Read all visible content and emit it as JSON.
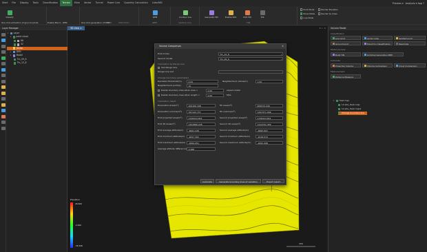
{
  "menubar": {
    "items": [
      "Start",
      "File",
      "Display",
      "Tools",
      "Classification",
      "Terrain",
      "Mine",
      "Vector",
      "Tunnel",
      "Power Line",
      "Quantity Calculation",
      "Lidar360"
    ],
    "active_index": 5,
    "right": {
      "themes": "Themes ▾",
      "help": "Analysis ▾  App  ?"
    }
  },
  "ribbon": {
    "groups": [
      {
        "label": "Classification"
      },
      {
        "label": "DEM"
      },
      {
        "label": "DEM"
      },
      {
        "label": "Contour line"
      },
      {
        "label": "TIN"
      }
    ],
    "buttons": {
      "classify": "Classify",
      "one_click_ground": "One click extraction of ground points",
      "enable_macro": "Enable Macro",
      "dem": "DEM",
      "one_click_dem": "One click generation of DEM",
      "dem_editor": "DEM Editor",
      "dem2": "DEM",
      "contour": "Contour line",
      "gen_tin": "Generate TIN",
      "enable_edit": "Enable Edit",
      "edit_tin": "Edit TIN",
      "tin": "TIN",
      "point_mode": "Point Mode",
      "render_elevation": "Render Elevation",
      "plane_mode": "Plane Mode",
      "render_by_class": "Render by Class",
      "line_mode": "Line Mode"
    }
  },
  "layer_manager": {
    "title": "Layer Manager",
    "root": "Layer",
    "items": [
      {
        "label": "point cloud",
        "depth": 1
      },
      {
        "label": "68",
        "depth": 2
      },
      {
        "label": "32",
        "depth": 2
      },
      {
        "label": "Vector",
        "depth": 1,
        "selected": true
      },
      {
        "label": "DEM",
        "depth": 1
      },
      {
        "label": "Model",
        "depth": 1
      },
      {
        "label": "Tin_09_6",
        "depth": 2
      },
      {
        "label": "Tin_12_8",
        "depth": 2
      }
    ]
  },
  "viewport": {
    "tab": "3D View ×",
    "legend": {
      "title": "Elevation",
      "max": "28.960",
      "mid": "-2.660",
      "min": "-36.298"
    },
    "scale": "200"
  },
  "dialog": {
    "title": "Volume Comparison",
    "first_model_label": "First model",
    "first_model_value": "Tin_12_8",
    "second_model_label": "Second model",
    "second_model_value": "Tin_09_6",
    "range_section": "Calculation by Range Line",
    "use_range_line": "Use Range Line",
    "range_line_list": "Range Line List",
    "params_section": "Change boundary parameters",
    "deviation_label": "Deviation threshold(m)",
    "deviation_value": "0.02",
    "neighborhood_radius_label": "Neighborhood radius(m)",
    "neighborhood_radius_value": "1.00",
    "neighborhood_points_label": "Neighborhood point(s)",
    "neighborhood_points_value": "10",
    "delete_area_label": "Delete boundary lines when area <",
    "delete_area_value": "0.00",
    "delete_area_unit": "square meter",
    "delete_length_label": "Delete boundary lines when length <",
    "delete_length_value": "0.00",
    "delete_length_unit": "Mtrs",
    "results_section": "Calculation result",
    "results": [
      {
        "l": "Excavation area(m²)",
        "lv": "469166.398",
        "r": "Fill area(m²)",
        "rv": "669570.049"
      },
      {
        "l": "Excavation volume(m³)",
        "lv": "397122.757",
        "r": "Fill volume(m³)",
        "rv": "1297371.946"
      },
      {
        "l": "First projected area(m²)",
        "lv": "1156224.821",
        "r": "Second projected area(m²)",
        "rv": "1156224.821"
      },
      {
        "l": "First 3D area(m²)",
        "lv": "1452886.228",
        "r": "Second 3D area(m²)",
        "rv": "1414791.459"
      },
      {
        "l": "First average altitude(m)",
        "lv": "-6641.228",
        "r": "Second average altitude(m)",
        "rv": "-6695.821"
      },
      {
        "l": "First minimum altitude(m)",
        "lv": "-9017.302",
        "r": "Second minimum altitude(m)",
        "rv": "-9118.072"
      },
      {
        "l": "First maximum altitude(m)",
        "lv": "-4829.951",
        "r": "Second maximum altitude(m)",
        "rv": "-4832.998"
      },
      {
        "l": "Average altitude difference(m)",
        "lv": "2.988",
        "r": "",
        "rv": ""
      }
    ],
    "btn_calculate": "Calculate",
    "btn_generate": "Generate boundary lines of variation",
    "btn_export": "Export report"
  },
  "right_panel": {
    "title": "Volume Model",
    "sec_classification": "Classification",
    "btn_low_point": "Low point",
    "btn_aerial_noise": "Aerial noise",
    "btn_isolated_point": "Isolated point",
    "btn_ground_point": "Ground point",
    "btn_export_by_class": "Export by Classification",
    "btn_resample": "Resample",
    "sec_model": "Model process",
    "btn_build_tin": "Build TIN",
    "btn_gen_dem": "Gridding Generation DEM",
    "sec_calc": "Calculate",
    "btn_projection": "Projection Volume",
    "btn_volume_comparison": "Volume Comparison",
    "btn_cloud_comparison": "Cloud Comparison",
    "sec_measure": "Measurement",
    "btn_distance": "Distance Measure",
    "tree_root": "Heat map",
    "tree_items": [
      "12-site_Heat map",
      "12-site_Heat map2"
    ],
    "tree_selected": "Change boundary line"
  },
  "colors": {
    "accent": "#d4631a",
    "active_tab": "#2e6b3f",
    "viewport_tab": "#3a5f8a",
    "terrain": "#e6e600"
  }
}
